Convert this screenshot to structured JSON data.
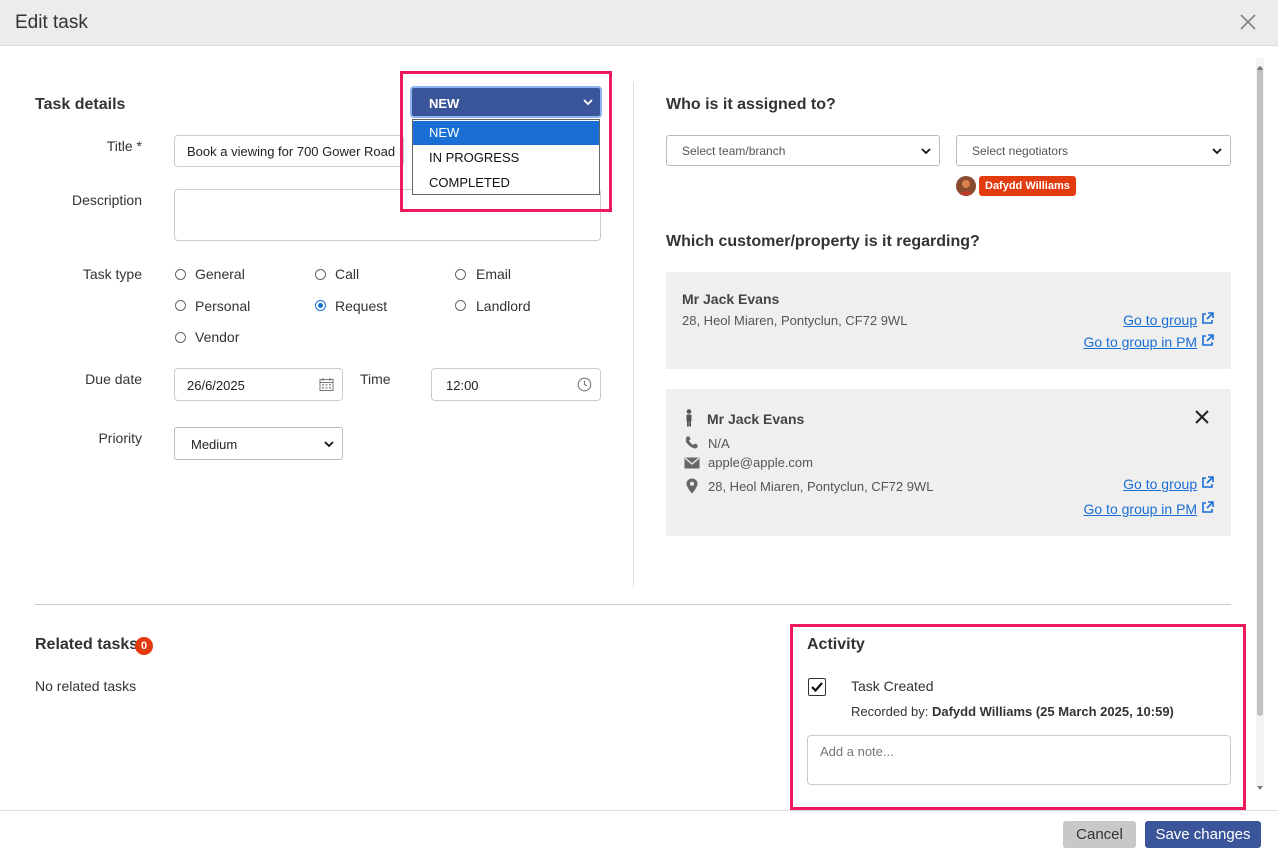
{
  "modal": {
    "title": "Edit task"
  },
  "task_details": {
    "heading": "Task details",
    "title_label": "Title *",
    "title_value": "Book a viewing for 700 Gower Road",
    "description_label": "Description",
    "description_value": "",
    "task_type_label": "Task type",
    "task_types": [
      {
        "label": "General",
        "checked": false
      },
      {
        "label": "Call",
        "checked": false
      },
      {
        "label": "Email",
        "checked": false
      },
      {
        "label": "Personal",
        "checked": false
      },
      {
        "label": "Request",
        "checked": true
      },
      {
        "label": "Landlord",
        "checked": false
      },
      {
        "label": "Vendor",
        "checked": false
      }
    ],
    "due_date_label": "Due date",
    "due_date_value": "26/6/2025",
    "time_label": "Time",
    "time_value": "12:00",
    "priority_label": "Priority",
    "priority_value": "Medium"
  },
  "status": {
    "selected": "NEW",
    "options": [
      "NEW",
      "IN PROGRESS",
      "COMPLETED"
    ]
  },
  "assigned": {
    "heading": "Who is it assigned to?",
    "team_placeholder": "Select team/branch",
    "negotiator_placeholder": "Select negotiators",
    "assignee_badge": "Dafydd Williams"
  },
  "regarding": {
    "heading": "Which customer/property is it regarding?",
    "card1": {
      "name": "Mr Jack Evans",
      "address": "28, Heol Miaren, Pontyclun, CF72 9WL",
      "link_group": "Go to group",
      "link_group_pm": "Go to group in PM"
    },
    "card2": {
      "name": "Mr Jack Evans",
      "phone": "N/A",
      "email": "apple@apple.com",
      "address": "28, Heol Miaren, Pontyclun, CF72 9WL",
      "link_group": "Go to group",
      "link_group_pm": "Go to group in PM"
    }
  },
  "related": {
    "heading": "Related tasks",
    "count": "0",
    "empty_text": "No related tasks"
  },
  "activity": {
    "heading": "Activity",
    "item_title": "Task Created",
    "recorded_prefix": "Recorded by:",
    "recorded_detail": "Dafydd Williams (25 March 2025, 10:59)",
    "note_placeholder": "Add a note..."
  },
  "footer": {
    "cancel_label": "Cancel",
    "save_label": "Save changes"
  },
  "colors": {
    "primary": "#3b559a",
    "highlight": "#ee1a5c",
    "link": "#1a6fd6",
    "badge": "#e23b0f"
  }
}
